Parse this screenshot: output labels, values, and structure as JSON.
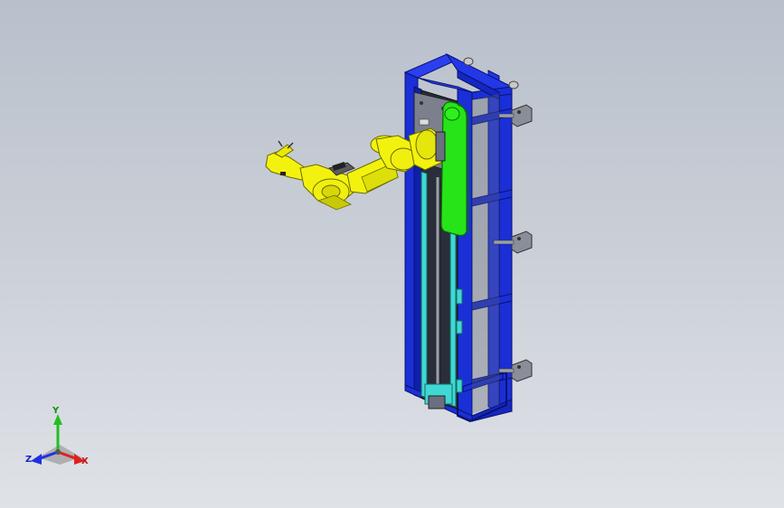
{
  "viewport": {
    "background_top": "#b9c0cb",
    "background_bottom": "#dfe2e7"
  },
  "model": {
    "frame_color": "#1a2fd6",
    "arm_color": "#f3f20f",
    "belt_color": "#27e418",
    "rail_color": "#3fd8d2"
  },
  "triad": {
    "x_label": "X",
    "y_label": "Y",
    "z_label": "Z",
    "x_color": "#e02020",
    "y_color": "#20c020",
    "z_color": "#2030e0"
  }
}
